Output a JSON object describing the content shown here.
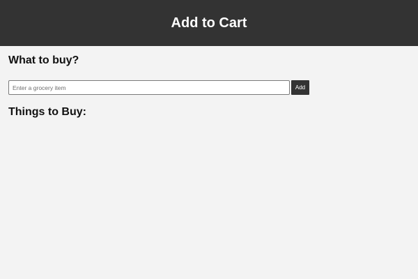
{
  "header": {
    "title": "Add to Cart"
  },
  "form": {
    "heading": "What to buy?",
    "input_value": "",
    "input_placeholder": "Enter a grocery item",
    "add_label": "Add"
  },
  "list": {
    "heading": "Things to Buy:",
    "items": []
  },
  "colors": {
    "header_bg": "#333333",
    "page_bg": "#f3f3f3",
    "button_bg": "#333333",
    "button_text": "#ffffff"
  }
}
